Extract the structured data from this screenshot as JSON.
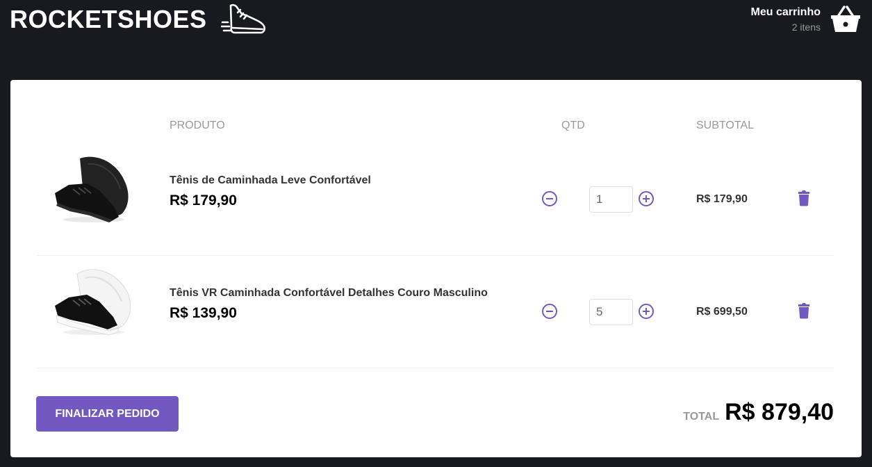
{
  "header": {
    "logo": "ROCKETSHOES",
    "logo_icon": "sneaker-icon",
    "cart_title": "Meu carrinho",
    "cart_count": "2 itens",
    "cart_icon": "basket-icon"
  },
  "table": {
    "headers": {
      "product": "PRODUTO",
      "qty": "QTD",
      "subtotal": "SUBTOTAL"
    },
    "rows": [
      {
        "title": "Tênis de Caminhada Leve Confortável",
        "price": "R$ 179,90",
        "quantity": "1",
        "subtotal": "R$ 179,90",
        "image_icon": "black-sneaker-image"
      },
      {
        "title": "Tênis VR Caminhada Confortável Detalhes Couro Masculino",
        "price": "R$ 139,90",
        "quantity": "5",
        "subtotal": "R$ 699,50",
        "image_icon": "black-white-sneaker-image"
      }
    ]
  },
  "footer": {
    "finish_label": "FINALIZAR PEDIDO",
    "total_label": "TOTAL",
    "total_value": "R$ 879,40"
  },
  "colors": {
    "accent": "#7159c1",
    "background": "#191920"
  }
}
